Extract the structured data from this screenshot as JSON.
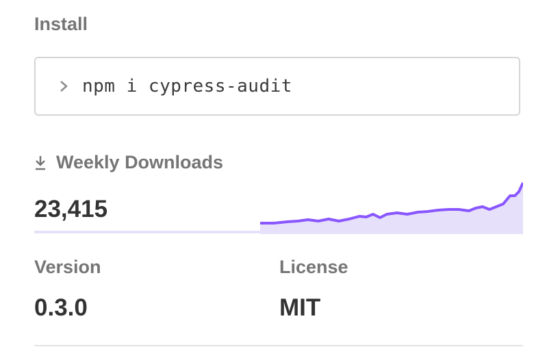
{
  "install": {
    "label": "Install",
    "command": "npm i cypress-audit",
    "prompt_icon": "chevron-right-icon"
  },
  "downloads": {
    "icon": "download-icon",
    "label": "Weekly Downloads",
    "count": "23,415",
    "accent_color": "#8956ff",
    "fill_color": "#e6e0fb"
  },
  "version": {
    "label": "Version",
    "value": "0.3.0"
  },
  "license": {
    "label": "License",
    "value": "MIT"
  }
}
